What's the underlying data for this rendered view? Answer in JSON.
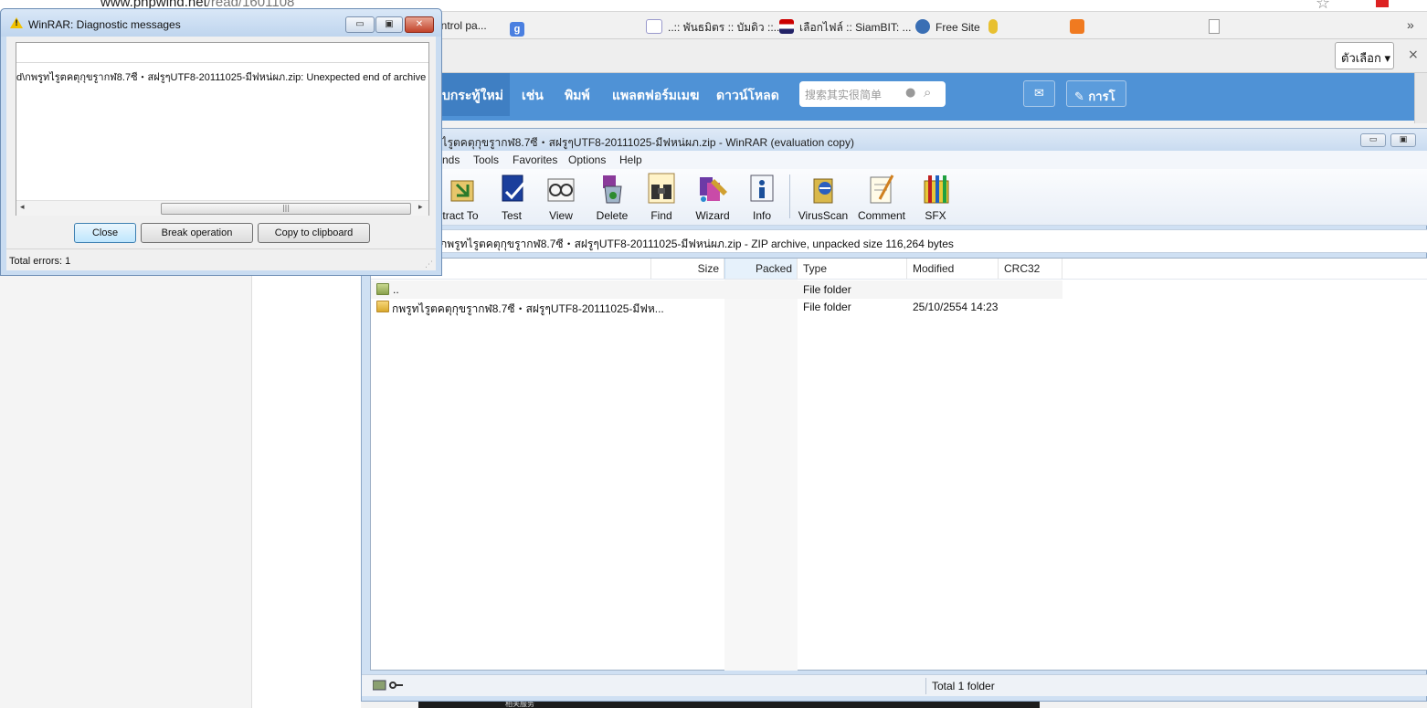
{
  "browser": {
    "url_main": "www.phpwind.net",
    "url_path": "/read/1601108",
    "bookmarks": [
      "control pa...",
      "..:: พันธมิตร :: บัมดิว ::..",
      "เลือกไฟล์ :: SiamBIT: ...",
      "Free Site"
    ],
    "bookmarks_more": "»",
    "options_button": "ตัวเลือก ▾",
    "close_x": "×"
  },
  "site": {
    "nav_items": [
      "บกระทู้ใหม่",
      "เช่น",
      "พิมพ์",
      "แพลตฟอร์มเมฆ",
      "ดาวน์โหลด"
    ],
    "search_placeholder": "搜索其实很简单",
    "post_button": "การโ",
    "mail_icon_char": "✉",
    "bottom_strip_text": "相关服务",
    "bottom_strip_arrow": "^"
  },
  "winrar": {
    "title": "กพรูทไรูตคตุกุขรูากฬ8.7ซี・สฝรูๆUTF8-20111025-มีฟหน่ผภ.zip - WinRAR (evaluation copy)",
    "menu": [
      "nds",
      "Tools",
      "Favorites",
      "Options",
      "Help"
    ],
    "toolbar": [
      {
        "label": "tract To",
        "icon": "extract-icon"
      },
      {
        "label": "Test",
        "icon": "test-icon"
      },
      {
        "label": "View",
        "icon": "view-icon"
      },
      {
        "label": "Delete",
        "icon": "delete-icon"
      },
      {
        "label": "Find",
        "icon": "find-icon"
      },
      {
        "label": "Wizard",
        "icon": "wizard-icon"
      },
      {
        "label": "Info",
        "icon": "info-icon"
      },
      {
        "label": "VirusScan",
        "icon": "virusscan-icon"
      },
      {
        "label": "Comment",
        "icon": "comment-icon"
      },
      {
        "label": "SFX",
        "icon": "sfx-icon"
      }
    ],
    "path": "กพรูทไรูตคตุกุขรูากฬ8.7ซี・สฝรูๆUTF8-20111025-มีฟหน่ผภ.zip - ZIP archive, unpacked size 116,264 bytes",
    "columns": [
      "Size",
      "Packed",
      "Type",
      "Modified",
      "CRC32"
    ],
    "rows": [
      {
        "name": "..",
        "size": "",
        "packed": "",
        "type": "File folder",
        "modified": "",
        "crc": ""
      },
      {
        "name": "กพรูทไรูตคตุกุขรูากฬ8.7ซี・สฝรูๆUTF8-20111025-มีฟห...",
        "size": "",
        "packed": "",
        "type": "File folder",
        "modified": "25/10/2554 14:23",
        "crc": ""
      }
    ],
    "status": "Total 1 folder"
  },
  "dialog": {
    "title": "WinRAR: Diagnostic messages",
    "message": "d\\กพรูทไรูตคตุกุขรูากฬ8.7ซี・สฝรูๆUTF8-20111025-มีฟหน่ผภ.zip: Unexpected end of archive",
    "buttons": {
      "close": "Close",
      "break": "Break operation",
      "copy": "Copy to clipboard"
    },
    "status": "Total errors: 1",
    "scroll_left": "◂",
    "scroll_right": "▸",
    "scroll_grip": "|||"
  }
}
